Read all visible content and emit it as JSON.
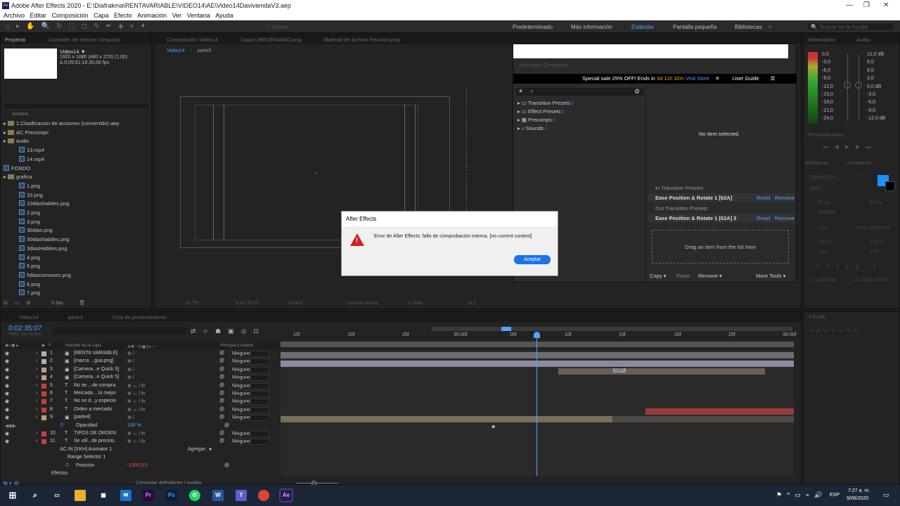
{
  "window": {
    "title": "Adobe After Effects 2020 - E:\\Diafrakma\\RENTAVARIABLE\\VIDEO14\\AE\\Video14DaviviendaV3.aep"
  },
  "menu": [
    "Archivo",
    "Editar",
    "Composición",
    "Capa",
    "Efecto",
    "Animación",
    "Ver",
    "Ventana",
    "Ayuda"
  ],
  "workspaces": [
    "Predeterminado",
    "Más información",
    "Estándar",
    "Pantalla pequeña",
    "Bibliotecas"
  ],
  "workspace_active": "Estándar",
  "search_help_placeholder": "Buscar en la Ayuda",
  "project": {
    "tabs": [
      "Proyecto",
      "Controles de efectos (ninguno)"
    ],
    "comp_name": "Video14 ▼",
    "comp_info": [
      "1920 x 1080 (480 x 270) (1,00)",
      "Δ 0;05;51;18,30,00 fps"
    ],
    "col_name": "Nombre",
    "items": [
      {
        "name": "1.Clasificacion de acciones (convertido).aep",
        "type": "folder",
        "indent": 0
      },
      {
        "name": "AC Precomps",
        "type": "folder",
        "indent": 0
      },
      {
        "name": "audio",
        "type": "folder",
        "indent": 0
      },
      {
        "name": "13.mp4",
        "type": "file",
        "indent": 1
      },
      {
        "name": "14.mp4",
        "type": "file",
        "indent": 1
      },
      {
        "name": "FONDO",
        "type": "comp",
        "indent": 0
      },
      {
        "name": "grafica",
        "type": "folder",
        "indent": 0
      },
      {
        "name": "1.png",
        "type": "file",
        "indent": 1
      },
      {
        "name": "10.png",
        "type": "file",
        "indent": 1
      },
      {
        "name": "10diashabiles.png",
        "type": "file",
        "indent": 1
      },
      {
        "name": "2.png",
        "type": "file",
        "indent": 1
      },
      {
        "name": "3.png",
        "type": "file",
        "indent": 1
      },
      {
        "name": "30dias.png",
        "type": "file",
        "indent": 1
      },
      {
        "name": "30diashabiles.png",
        "type": "file",
        "indent": 1
      },
      {
        "name": "3diasHabiles.png",
        "type": "file",
        "indent": 1
      },
      {
        "name": "4.png",
        "type": "file",
        "indent": 1
      },
      {
        "name": "5.png",
        "type": "file",
        "indent": 1
      },
      {
        "name": "5diascomunes.png",
        "type": "file",
        "indent": 1
      },
      {
        "name": "6.png",
        "type": "file",
        "indent": 1
      },
      {
        "name": "7.png",
        "type": "file",
        "indent": 1
      }
    ],
    "bpc": "8 bpc"
  },
  "comp_panel": {
    "tabs": [
      "Composición Video14",
      "Capa LIBROFAVADO.png",
      "Material de archivo Reunion.png"
    ],
    "crumbs": [
      "Video14",
      "parte5"
    ],
    "footer": [
      "33,7%",
      "0;02:35:07",
      "Cuarto",
      "Cámara activa",
      "1 Vista",
      "+0,0"
    ]
  },
  "animation_composer": {
    "title": "Animation Composer",
    "sale_text": "Special sale 25% OFF! Ends in",
    "sale_time": "3d 11h 32m",
    "visit_store": "Visit Store",
    "user_guide": "User Guide",
    "tree": [
      "Transition Presets",
      "Effect Presets",
      "Precomps",
      "Sounds"
    ],
    "no_item": "No item selected.",
    "in_label": "In Transition Presets",
    "in_item": "Ease Position & Rotate 1 [62A]",
    "out_label": "Out Transition Presets",
    "out_item": "Ease Position & Rotate 1 [62A] 2",
    "reset": "Reset",
    "remove": "Remove",
    "drag_text": "Drag an item from the list here",
    "bottom": [
      "Copy ▾",
      "Paste",
      "Remove ▾",
      "More Tools ▾"
    ]
  },
  "dialog": {
    "title": "After Effects",
    "message": "Error de After Effects: fallo de comprobación interna, [no current context]",
    "button": "Aceptar"
  },
  "right_panels": {
    "info_tab": "Información",
    "audio_tab": "Audio",
    "audio_left": [
      "0,0",
      "-3,0",
      "-6,0",
      "-9,0",
      "-12,0",
      "-15,0",
      "-18,0",
      "-21,0",
      "-24,0"
    ],
    "audio_right": [
      "12,0 dB",
      "9,0",
      "6,0",
      "3,0",
      "0,0 dB",
      "-3,0",
      "-6,0",
      "-9,0",
      "-12,0 dB"
    ],
    "preview_tab": "Previsualización",
    "libraries_tab": "Bibliotecas",
    "chars_tab": "Caracteres",
    "font": "Myriad Pro",
    "font_style": "Bold",
    "font_size": "75 px",
    "leading": "60 px",
    "tracking": "Medidas",
    "stroke": "0 px",
    "stroke_mode": "Trazo sobre rell.",
    "scale_v": "100 %",
    "scale_h": "100 %",
    "baseline": "0 px",
    "tsume": "0 %",
    "ligatures": "Ligaduras",
    "hindi": "Dígitos hindi",
    "paragraph_tab": "Párrafo"
  },
  "timeline": {
    "tabs": [
      "Video14",
      "parte4",
      "Cola de procesamiento"
    ],
    "timecode": "0:02:35:07",
    "timecode_sub": "04657 (30.00 fps)",
    "col_name": "Nombre de la capa",
    "col_parent": "Principal y enlace",
    "ruler": [
      "15f",
      "20f",
      "25f",
      "35:00f",
      "05f",
      "10f",
      "15f",
      "20f",
      "25f",
      "36:00f"
    ],
    "layers": [
      {
        "num": "1",
        "name": "[RENTA VARIABLE]",
        "parent": "Ninguno",
        "color": "#b0b0b0",
        "type": "comp"
      },
      {
        "num": "2",
        "name": "[marca ...gua.png]",
        "parent": "Ninguno",
        "color": "#b0b0b0",
        "type": "file"
      },
      {
        "num": "3",
        "name": "[Camera...e Quick 5]",
        "parent": "Ninguno",
        "color": "#b8a080",
        "type": "comp"
      },
      {
        "num": "4",
        "name": "[Camera...e Quick 5]",
        "parent": "Ninguno",
        "color": "#b8a080",
        "type": "comp"
      },
      {
        "num": "5",
        "name": "No se ...de compra.",
        "parent": "Ninguno",
        "color": "#c04040",
        "type": "text"
      },
      {
        "num": "6",
        "name": "Mercado... lo mejor",
        "parent": "Ninguno",
        "color": "#c04040",
        "type": "text"
      },
      {
        "num": "7",
        "name": "No se d...y especie.",
        "parent": "Ninguno",
        "color": "#c04040",
        "type": "text"
      },
      {
        "num": "8",
        "name": "Orden a mercado",
        "parent": "Ninguno",
        "color": "#c04040",
        "type": "text"
      },
      {
        "num": "9",
        "name": "[parte4]",
        "parent": "Ninguno",
        "color": "#b8a080",
        "type": "comp"
      }
    ],
    "opacity_label": "Opacidad",
    "opacity_value": "100 %",
    "layers2": [
      {
        "num": "10",
        "name": "TIPOS DE ORDEN",
        "parent": "Ninguno",
        "color": "#c04040",
        "type": "text"
      },
      {
        "num": "11",
        "name": "Se util...de precios.",
        "parent": "Ninguno",
        "color": "#c04040",
        "type": "text"
      }
    ],
    "animator": "AC IN [XKH] Animator 1",
    "add_label": "Agregar:",
    "range": "Range Selector 1",
    "position_label": "Posición",
    "position_value": "-1300,0,0",
    "effects_label": "Efectos",
    "switch_label": "Conmutar definidores / modos",
    "cut_label": "CUT"
  },
  "taskbar": {
    "apps": [
      "Pr",
      "Ps",
      "W",
      "Ae"
    ],
    "lang": "ESP",
    "time": "7:27 a. m.",
    "date": "9/06/2020"
  }
}
